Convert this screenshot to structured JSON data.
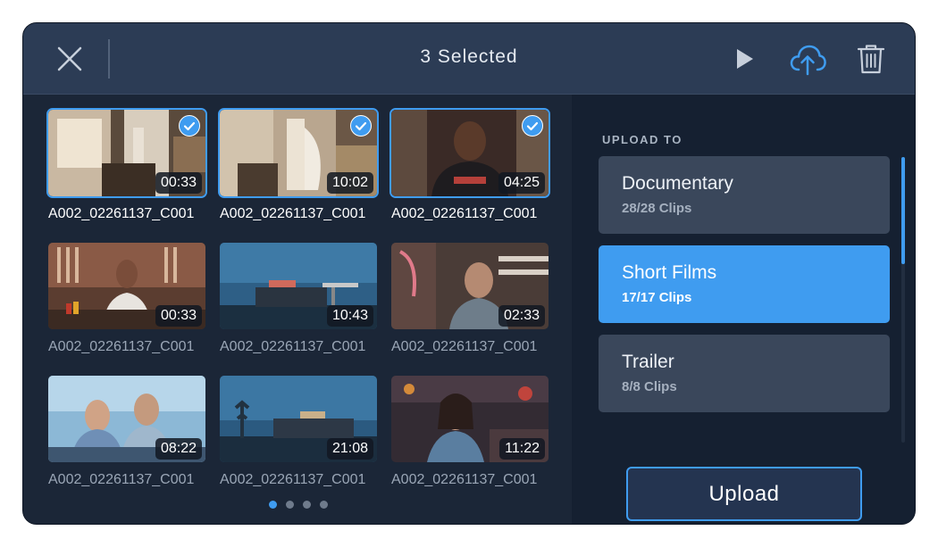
{
  "header": {
    "title": "3 Selected",
    "close_icon": "close-icon",
    "play_icon": "play-icon",
    "upload_icon": "cloud-upload-icon",
    "delete_icon": "trash-icon"
  },
  "clips": [
    {
      "name": "A002_02261137_C001",
      "duration": "00:33",
      "selected": true
    },
    {
      "name": "A002_02261137_C001",
      "duration": "10:02",
      "selected": true
    },
    {
      "name": "A002_02261137_C001",
      "duration": "04:25",
      "selected": true
    },
    {
      "name": "A002_02261137_C001",
      "duration": "00:33",
      "selected": false
    },
    {
      "name": "A002_02261137_C001",
      "duration": "10:43",
      "selected": false
    },
    {
      "name": "A002_02261137_C001",
      "duration": "02:33",
      "selected": false
    },
    {
      "name": "A002_02261137_C001",
      "duration": "08:22",
      "selected": false
    },
    {
      "name": "A002_02261137_C001",
      "duration": "21:08",
      "selected": false
    },
    {
      "name": "A002_02261137_C001",
      "duration": "11:22",
      "selected": false
    }
  ],
  "pagination": {
    "pages": 4,
    "current": 1
  },
  "upload_panel": {
    "heading": "UPLOAD TO",
    "destinations": [
      {
        "name": "Documentary",
        "count": "28/28 Clips",
        "active": false
      },
      {
        "name": "Short Films",
        "count": "17/17 Clips",
        "active": true
      },
      {
        "name": "Trailer",
        "count": "8/8 Clips",
        "active": false
      }
    ],
    "upload_label": "Upload"
  },
  "colors": {
    "accent": "#3f9cf0",
    "header_bg": "#2c3c55",
    "panel_bg": "#1b2637",
    "card_bg": "#3a475b"
  }
}
